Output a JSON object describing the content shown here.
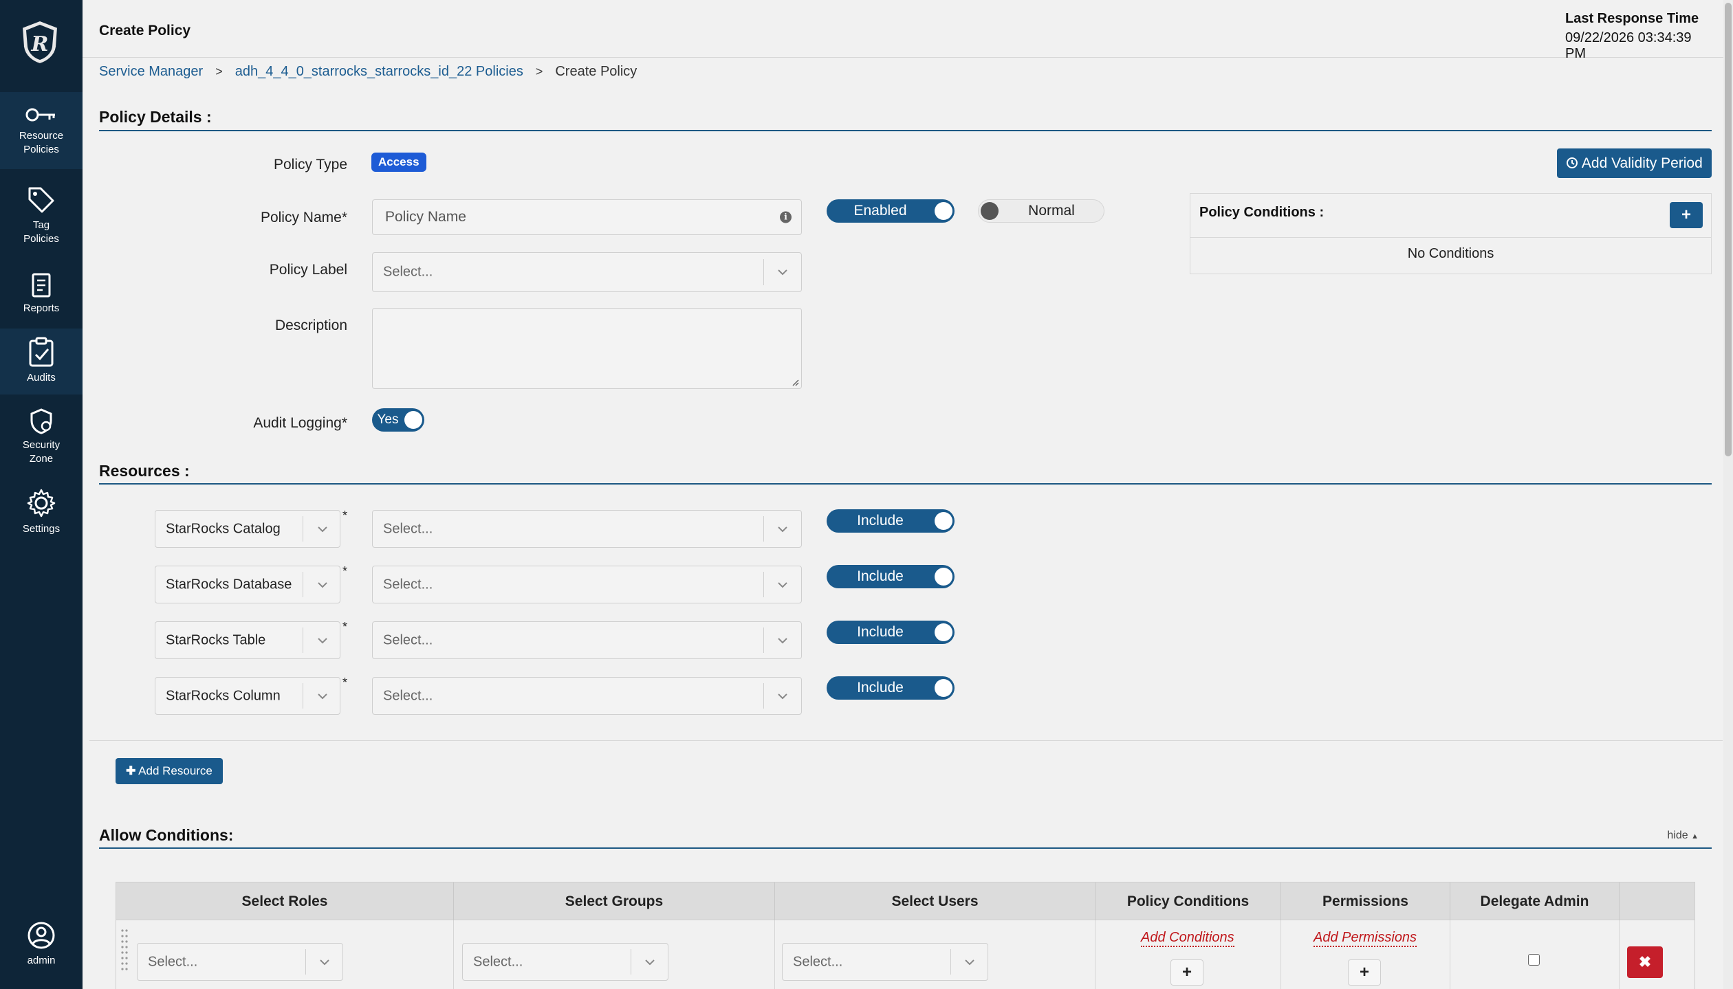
{
  "sidebar": {
    "items": [
      {
        "label_line1": "Resource",
        "label_line2": "Policies",
        "icon": "key-icon"
      },
      {
        "label_line1": "Tag",
        "label_line2": "Policies",
        "icon": "tag-icon"
      },
      {
        "label_line1": "Reports",
        "icon": "report-icon"
      },
      {
        "label_line1": "Audits",
        "icon": "clipboard-check-icon"
      },
      {
        "label_line1": "Security",
        "label_line2": "Zone",
        "icon": "shield-icon"
      },
      {
        "label_line1": "Settings",
        "icon": "gear-icon"
      }
    ],
    "user": {
      "label": "admin",
      "icon": "user-icon"
    }
  },
  "header": {
    "title": "Create Policy",
    "response_label": "Last Response Time",
    "response_value": "09/22/2026 03:34:39 PM"
  },
  "breadcrumb": {
    "items": [
      "Service Manager",
      "adh_4_4_0_starrocks_starrocks_id_22 Policies",
      "Create Policy"
    ],
    "separator": ">"
  },
  "policy_details": {
    "section_title": "Policy Details :",
    "policy_type_label": "Policy Type",
    "policy_type_value": "Access",
    "validity_button": "Add Validity Period",
    "policy_name_label": "Policy Name*",
    "policy_name_placeholder": "Policy Name",
    "policy_label_label": "Policy Label",
    "policy_label_placeholder": "Select...",
    "description_label": "Description",
    "audit_logging_label": "Audit Logging*",
    "audit_logging_value": "Yes",
    "enabled_toggle": "Enabled",
    "normal_toggle": "Normal",
    "conditions_title": "Policy Conditions :",
    "conditions_add": "+",
    "conditions_empty": "No Conditions"
  },
  "resources": {
    "section_title": "Resources :",
    "rows": [
      {
        "type": "StarRocks Catalog",
        "placeholder": "Select...",
        "toggle": "Include"
      },
      {
        "type": "StarRocks Database",
        "placeholder": "Select...",
        "toggle": "Include"
      },
      {
        "type": "StarRocks Table",
        "placeholder": "Select...",
        "toggle": "Include"
      },
      {
        "type": "StarRocks Column",
        "placeholder": "Select...",
        "toggle": "Include"
      }
    ],
    "required_mark": "*",
    "add_button": "Add Resource"
  },
  "allow_conditions": {
    "section_title": "Allow Conditions:",
    "hide_label": "hide",
    "columns": [
      "Select Roles",
      "Select Groups",
      "Select Users",
      "Policy Conditions",
      "Permissions",
      "Delegate Admin"
    ],
    "row": {
      "roles_placeholder": "Select...",
      "groups_placeholder": "Select...",
      "users_placeholder": "Select...",
      "add_conditions": "Add Conditions",
      "add_permissions": "Add Permissions",
      "plus": "+",
      "delete": "✖"
    }
  },
  "colors": {
    "sidebar_bg": "#0e2538",
    "primary": "#1a5a8c",
    "badge": "#1d5bd6",
    "danger": "#c51f2b",
    "link_red": "#c0171b"
  }
}
